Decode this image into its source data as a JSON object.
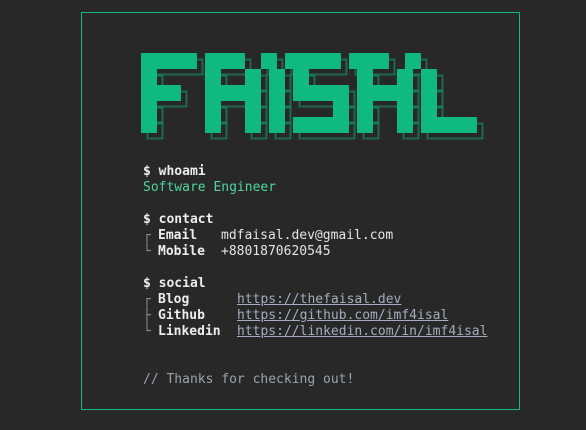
{
  "logo": {
    "text": "FAISAL",
    "color": "#10b981"
  },
  "whoami": {
    "prompt": "$ whoami",
    "output": "Software Engineer"
  },
  "contact": {
    "prompt": "$ contact",
    "items": [
      {
        "tree": "┌",
        "label": "Email",
        "value": "mdfaisal.dev@gmail.com"
      },
      {
        "tree": "└",
        "label": "Mobile",
        "value": "+8801870620545"
      }
    ]
  },
  "social": {
    "prompt": "$ social",
    "items": [
      {
        "tree": "┌",
        "label": "Blog",
        "url": "https://thefaisal.dev"
      },
      {
        "tree": "├",
        "label": "Github",
        "url": "https://github.com/imf4isal"
      },
      {
        "tree": "└",
        "label": "Linkedin",
        "url": "https://linkedin.com/in/imf4isal"
      }
    ]
  },
  "footer": {
    "comment": "// Thanks for checking out!"
  },
  "colors": {
    "accent": "#14b981",
    "background": "#282828",
    "link": "#a3adbf"
  }
}
